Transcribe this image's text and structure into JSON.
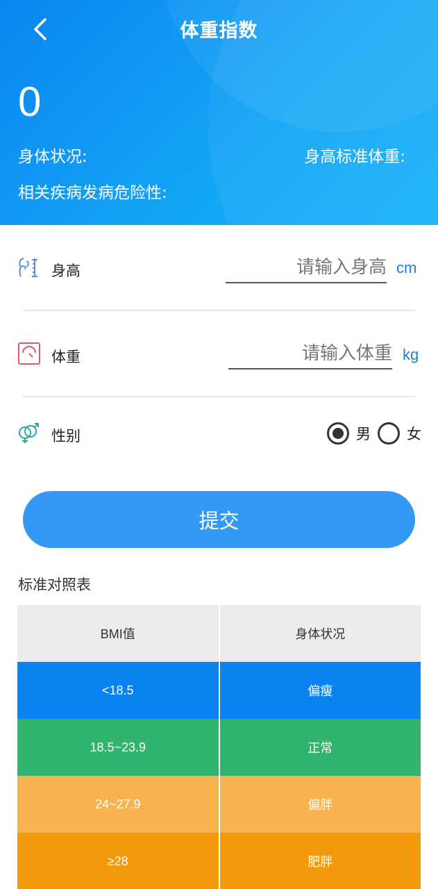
{
  "header": {
    "title": "体重指数",
    "bmi_value": "0",
    "status_label": "身体状况:",
    "std_weight_label": "身高标准体重:",
    "risk_label": "相关疾病发病危险性:"
  },
  "form": {
    "height": {
      "label": "身高",
      "placeholder": "请输入身高",
      "unit": "cm",
      "icon": "height-icon"
    },
    "weight": {
      "label": "体重",
      "placeholder": "请输入体重",
      "unit": "kg",
      "icon": "scale-icon"
    },
    "gender": {
      "label": "性别",
      "icon": "gender-icon",
      "options": [
        "男",
        "女"
      ],
      "selected": "男"
    },
    "submit_label": "提交"
  },
  "reference": {
    "title": "标准对照表",
    "headers": [
      "BMI值",
      "身体状况"
    ],
    "rows": [
      {
        "bmi": "<18.5",
        "status": "偏瘦",
        "color": "#0a82f0"
      },
      {
        "bmi": "18.5~23.9",
        "status": "正常",
        "color": "#31b46e"
      },
      {
        "bmi": "24~27.9",
        "status": "偏胖",
        "color": "#f7b350"
      },
      {
        "bmi": "≥28",
        "status": "肥胖",
        "color": "#f39a0c"
      }
    ]
  },
  "colors": {
    "accent": "#3399f3",
    "unit": "#1b7fd6"
  }
}
